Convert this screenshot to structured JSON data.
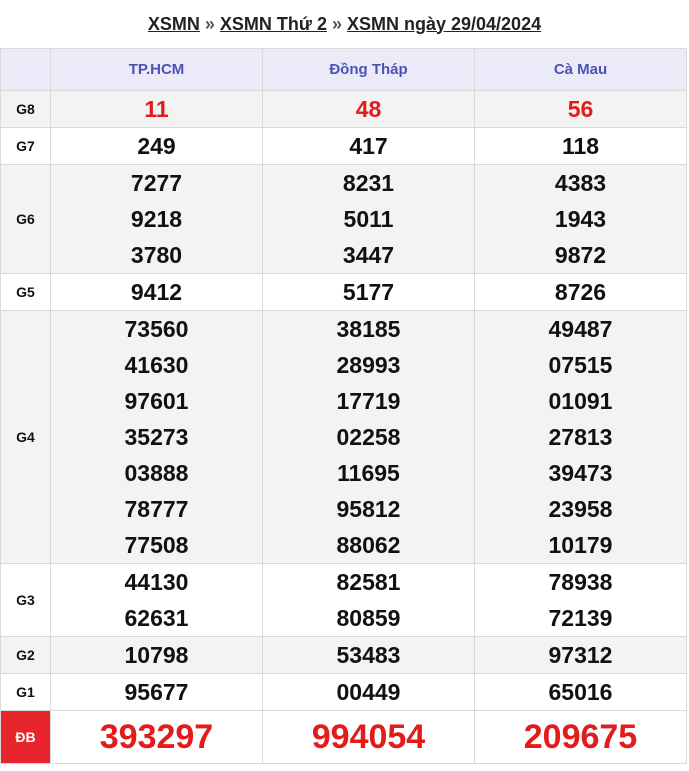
{
  "title": {
    "part1": "XSMN",
    "sep": "»",
    "part2": "XSMN Thứ 2",
    "part3": "XSMN ngày 29/04/2024"
  },
  "provinces": [
    "TP.HCM",
    "Đồng Tháp",
    "Cà Mau"
  ],
  "prizes": [
    {
      "label": "G8",
      "values": [
        [
          "11"
        ],
        [
          "48"
        ],
        [
          "56"
        ]
      ]
    },
    {
      "label": "G7",
      "values": [
        [
          "249"
        ],
        [
          "417"
        ],
        [
          "118"
        ]
      ]
    },
    {
      "label": "G6",
      "values": [
        [
          "7277",
          "9218",
          "3780"
        ],
        [
          "8231",
          "5011",
          "3447"
        ],
        [
          "4383",
          "1943",
          "9872"
        ]
      ]
    },
    {
      "label": "G5",
      "values": [
        [
          "9412"
        ],
        [
          "5177"
        ],
        [
          "8726"
        ]
      ]
    },
    {
      "label": "G4",
      "values": [
        [
          "73560",
          "41630",
          "97601",
          "35273",
          "03888",
          "78777",
          "77508"
        ],
        [
          "38185",
          "28993",
          "17719",
          "02258",
          "11695",
          "95812",
          "88062"
        ],
        [
          "49487",
          "07515",
          "01091",
          "27813",
          "39473",
          "23958",
          "10179"
        ]
      ]
    },
    {
      "label": "G3",
      "values": [
        [
          "44130",
          "62631"
        ],
        [
          "82581",
          "80859"
        ],
        [
          "78938",
          "72139"
        ]
      ]
    },
    {
      "label": "G2",
      "values": [
        [
          "10798"
        ],
        [
          "53483"
        ],
        [
          "97312"
        ]
      ]
    },
    {
      "label": "G1",
      "values": [
        [
          "95677"
        ],
        [
          "00449"
        ],
        [
          "65016"
        ]
      ]
    },
    {
      "label": "ĐB",
      "values": [
        [
          "393297"
        ],
        [
          "994054"
        ],
        [
          "209675"
        ]
      ]
    }
  ]
}
